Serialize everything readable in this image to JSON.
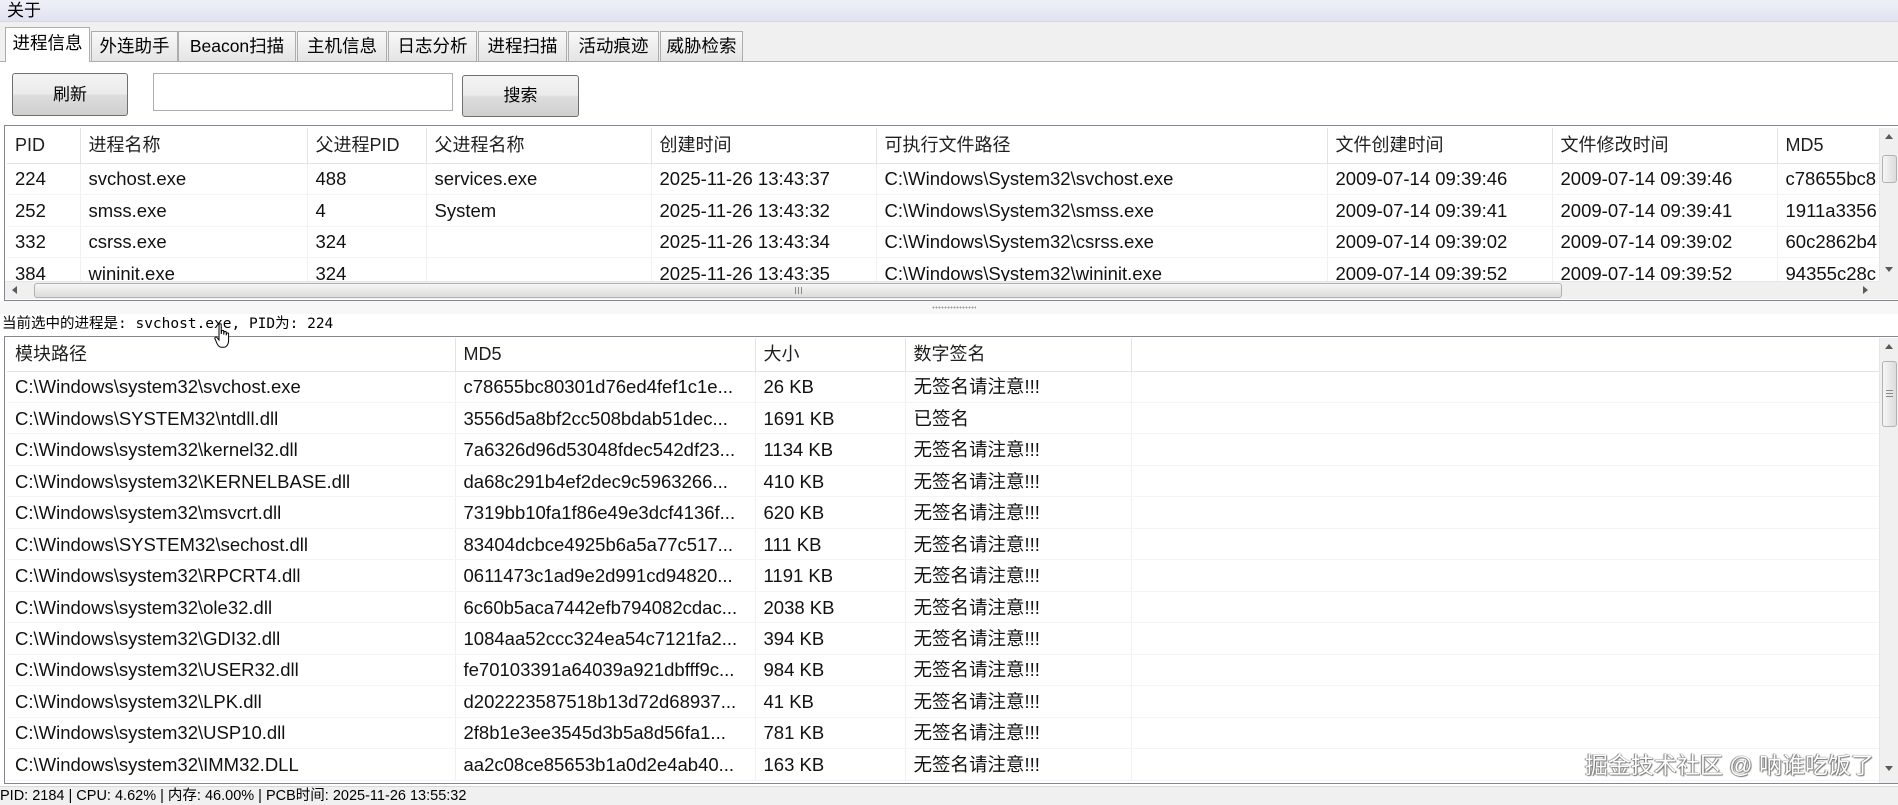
{
  "menu": {
    "about_label": "关于"
  },
  "tabs": [
    {
      "label": "进程信息",
      "active": true
    },
    {
      "label": "外连助手"
    },
    {
      "label": "Beacon扫描"
    },
    {
      "label": "主机信息"
    },
    {
      "label": "日志分析"
    },
    {
      "label": "进程扫描"
    },
    {
      "label": "活动痕迹"
    },
    {
      "label": "威胁检索"
    }
  ],
  "toolbar": {
    "refresh_label": "刷新",
    "search_value": "",
    "search_label": "搜索"
  },
  "process_table": {
    "columns": [
      "PID",
      "进程名称",
      "父进程PID",
      "父进程名称",
      "创建时间",
      "可执行文件路径",
      "文件创建时间",
      "文件修改时间",
      "MD5"
    ],
    "rows": [
      [
        "224",
        "svchost.exe",
        "488",
        "services.exe",
        "2025-11-26 13:43:37",
        "C:\\Windows\\System32\\svchost.exe",
        "2009-07-14 09:39:46",
        "2009-07-14 09:39:46",
        "c78655bc8"
      ],
      [
        "252",
        "smss.exe",
        "4",
        "System",
        "2025-11-26 13:43:32",
        "C:\\Windows\\System32\\smss.exe",
        "2009-07-14 09:39:41",
        "2009-07-14 09:39:41",
        "1911a3356"
      ],
      [
        "332",
        "csrss.exe",
        "324",
        "",
        "2025-11-26 13:43:34",
        "C:\\Windows\\System32\\csrss.exe",
        "2009-07-14 09:39:02",
        "2009-07-14 09:39:02",
        "60c2862b4"
      ],
      [
        "384",
        "wininit.exe",
        "324",
        "",
        "2025-11-26 13:43:35",
        "C:\\Windows\\System32\\wininit.exe",
        "2009-07-14 09:39:52",
        "2009-07-14 09:39:52",
        "94355c28c"
      ]
    ]
  },
  "selection_label": "当前选中的进程是: svchost.exe, PID为: 224",
  "module_table": {
    "columns": [
      "模块路径",
      "MD5",
      "大小",
      "数字签名"
    ],
    "rows": [
      [
        "C:\\Windows\\system32\\svchost.exe",
        "c78655bc80301d76ed4fef1c1e...",
        "26 KB",
        "无签名请注意!!!"
      ],
      [
        "C:\\Windows\\SYSTEM32\\ntdll.dll",
        "3556d5a8bf2cc508bdab51dec...",
        "1691 KB",
        "已签名"
      ],
      [
        "C:\\Windows\\system32\\kernel32.dll",
        "7a6326d96d53048fdec542df23...",
        "1134 KB",
        "无签名请注意!!!"
      ],
      [
        "C:\\Windows\\system32\\KERNELBASE.dll",
        "da68c291b4ef2dec9c5963266...",
        "410 KB",
        "无签名请注意!!!"
      ],
      [
        "C:\\Windows\\system32\\msvcrt.dll",
        "7319bb10fa1f86e49e3dcf4136f...",
        "620 KB",
        "无签名请注意!!!"
      ],
      [
        "C:\\Windows\\SYSTEM32\\sechost.dll",
        "83404dcbce4925b6a5a77c517...",
        "111 KB",
        "无签名请注意!!!"
      ],
      [
        "C:\\Windows\\system32\\RPCRT4.dll",
        "0611473c1ad9e2d991cd94820...",
        "1191 KB",
        "无签名请注意!!!"
      ],
      [
        "C:\\Windows\\system32\\ole32.dll",
        "6c60b5aca7442efb794082cdac...",
        "2038 KB",
        "无签名请注意!!!"
      ],
      [
        "C:\\Windows\\system32\\GDI32.dll",
        "1084aa52ccc324ea54c7121fa2...",
        "394 KB",
        "无签名请注意!!!"
      ],
      [
        "C:\\Windows\\system32\\USER32.dll",
        "fe70103391a64039a921dbfff9c...",
        "984 KB",
        "无签名请注意!!!"
      ],
      [
        "C:\\Windows\\system32\\LPK.dll",
        "d202223587518b13d72d68937...",
        "41 KB",
        "无签名请注意!!!"
      ],
      [
        "C:\\Windows\\system32\\USP10.dll",
        "2f8b1e3ee3545d3b5a8d56fa1...",
        "781 KB",
        "无签名请注意!!!"
      ],
      [
        "C:\\Windows\\system32\\IMM32.DLL",
        "aa2c08ce85653b1a0d2e4ab40...",
        "163 KB",
        "无签名请注意!!!"
      ]
    ]
  },
  "watermark": "掘金技术社区 @ 呐谁吃饭了",
  "status_bar": {
    "text": "PID: 2184 | CPU: 4.62% | 内存: 46.00% | PCB时间: 2025-11-26 13:55:32"
  },
  "icons": [
    "scroll-up-arrow-icon",
    "scroll-down-arrow-icon",
    "scroll-left-arrow-icon",
    "scroll-right-arrow-icon",
    "scroll-grip-icon",
    "splitter-grip-icon",
    "mouse-cursor-icon"
  ],
  "colors": {
    "menubar": "#e6e9f4",
    "panel": "#ffffff",
    "chrome": "#f0f0f0",
    "frame_border": "#828790"
  }
}
